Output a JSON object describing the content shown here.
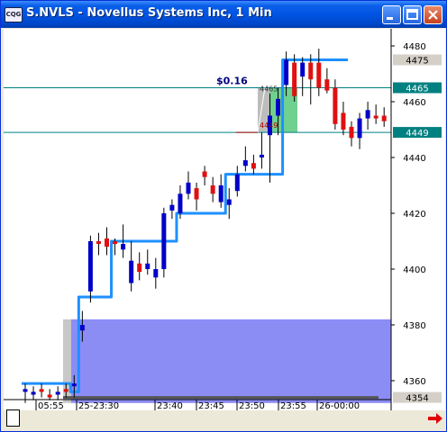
{
  "window": {
    "title": "S.NVLS - Novellus Systems Inc, 1 Min",
    "icon_text": "CQG"
  },
  "chart_data": {
    "type": "candlestick",
    "symbol": "S.NVLS",
    "interval": "1 Min",
    "ylim": [
      4350,
      4485
    ],
    "y_ticks": [
      "4480",
      "4460",
      "4440",
      "4420",
      "4400",
      "4380",
      "4360"
    ],
    "x_labels": [
      "05:55",
      "25-23:30",
      "23:40",
      "23:45",
      "23:50",
      "23:55",
      "26-00:00"
    ],
    "price_tags": [
      {
        "value": 4475,
        "label": "4475",
        "color": "#d4d0c8"
      },
      {
        "value": 4465,
        "label": "4465",
        "color": "#008080"
      },
      {
        "value": 4449,
        "label": "4449",
        "color": "#008080"
      },
      {
        "value": 4354,
        "label": "4354",
        "color": "#d4d0c8"
      }
    ],
    "horizontal_lines": [
      4465,
      4449
    ],
    "annotation": {
      "label": "$0.16",
      "from_label": "4449",
      "to_label": "4465",
      "from": 4449,
      "to": 4465
    },
    "candles": [
      {
        "o": 4356,
        "h": 4359,
        "l": 4352,
        "c": 4357,
        "color": "blue"
      },
      {
        "o": 4356,
        "h": 4358,
        "l": 4353,
        "c": 4355,
        "color": "blue"
      },
      {
        "o": 4357,
        "h": 4359,
        "l": 4354,
        "c": 4356,
        "color": "red"
      },
      {
        "o": 4355,
        "h": 4357,
        "l": 4353,
        "c": 4354,
        "color": "red"
      },
      {
        "o": 4355,
        "h": 4358,
        "l": 4353,
        "c": 4356,
        "color": "blue"
      },
      {
        "o": 4357,
        "h": 4359,
        "l": 4354,
        "c": 4356,
        "color": "red"
      },
      {
        "o": 4359,
        "h": 4362,
        "l": 4354,
        "c": 4358,
        "color": "blue"
      },
      {
        "o": 4378,
        "h": 4385,
        "l": 4374,
        "c": 4380,
        "color": "blue"
      },
      {
        "o": 4392,
        "h": 4412,
        "l": 4388,
        "c": 4410,
        "color": "blue"
      },
      {
        "o": 4410,
        "h": 4413,
        "l": 4405,
        "c": 4409,
        "color": "red"
      },
      {
        "o": 4411,
        "h": 4415,
        "l": 4405,
        "c": 4408,
        "color": "red"
      },
      {
        "o": 4409,
        "h": 4411,
        "l": 4405,
        "c": 4410,
        "color": "red"
      },
      {
        "o": 4409,
        "h": 4416,
        "l": 4404,
        "c": 4407,
        "color": "blue"
      },
      {
        "o": 4403,
        "h": 4410,
        "l": 4392,
        "c": 4395,
        "color": "blue"
      },
      {
        "o": 4402,
        "h": 4406,
        "l": 4396,
        "c": 4399,
        "color": "red"
      },
      {
        "o": 4402,
        "h": 4407,
        "l": 4398,
        "c": 4400,
        "color": "blue"
      },
      {
        "o": 4400,
        "h": 4404,
        "l": 4393,
        "c": 4397,
        "color": "blue"
      },
      {
        "o": 4420,
        "h": 4422,
        "l": 4397,
        "c": 4400,
        "color": "blue"
      },
      {
        "o": 4421,
        "h": 4425,
        "l": 4418,
        "c": 4423,
        "color": "blue"
      },
      {
        "o": 4427,
        "h": 4430,
        "l": 4418,
        "c": 4420,
        "color": "blue"
      },
      {
        "o": 4431,
        "h": 4435,
        "l": 4425,
        "c": 4427,
        "color": "blue"
      },
      {
        "o": 4425,
        "h": 4431,
        "l": 4421,
        "c": 4429,
        "color": "red"
      },
      {
        "o": 4435,
        "h": 4437,
        "l": 4430,
        "c": 4433,
        "color": "red"
      },
      {
        "o": 4430,
        "h": 4433,
        "l": 4424,
        "c": 4427,
        "color": "red"
      },
      {
        "o": 4430,
        "h": 4434,
        "l": 4422,
        "c": 4424,
        "color": "blue"
      },
      {
        "o": 4425,
        "h": 4429,
        "l": 4418,
        "c": 4423,
        "color": "blue"
      },
      {
        "o": 4434,
        "h": 4437,
        "l": 4426,
        "c": 4428,
        "color": "blue"
      },
      {
        "o": 4439,
        "h": 4444,
        "l": 4435,
        "c": 4437,
        "color": "blue"
      },
      {
        "o": 4438,
        "h": 4441,
        "l": 4434,
        "c": 4436,
        "color": "red"
      },
      {
        "o": 4441,
        "h": 4449,
        "l": 4436,
        "c": 4440,
        "color": "blue"
      },
      {
        "o": 4455,
        "h": 4463,
        "l": 4431,
        "c": 4448,
        "color": "blue"
      },
      {
        "o": 4461,
        "h": 4465,
        "l": 4448,
        "c": 4455,
        "color": "blue"
      },
      {
        "o": 4475,
        "h": 4478,
        "l": 4462,
        "c": 4466,
        "color": "blue"
      },
      {
        "o": 4474,
        "h": 4477,
        "l": 4460,
        "c": 4462,
        "color": "red"
      },
      {
        "o": 4474,
        "h": 4476,
        "l": 4462,
        "c": 4469,
        "color": "blue"
      },
      {
        "o": 4468,
        "h": 4477,
        "l": 4459,
        "c": 4474,
        "color": "red"
      },
      {
        "o": 4474,
        "h": 4479,
        "l": 4462,
        "c": 4465,
        "color": "red"
      },
      {
        "o": 4468,
        "h": 4472,
        "l": 4463,
        "c": 4464,
        "color": "red"
      },
      {
        "o": 4465,
        "h": 4468,
        "l": 4450,
        "c": 4452,
        "color": "red"
      },
      {
        "o": 4456,
        "h": 4460,
        "l": 4448,
        "c": 4450,
        "color": "red"
      },
      {
        "o": 4451,
        "h": 4453,
        "l": 4444,
        "c": 4447,
        "color": "red"
      },
      {
        "o": 4447,
        "h": 4456,
        "l": 4443,
        "c": 4454,
        "color": "blue"
      },
      {
        "o": 4454,
        "h": 4460,
        "l": 4450,
        "c": 4457,
        "color": "blue"
      },
      {
        "o": 4455,
        "h": 4459,
        "l": 4452,
        "c": 4454,
        "color": "red"
      },
      {
        "o": 4455,
        "h": 4458,
        "l": 4451,
        "c": 4453,
        "color": "red"
      }
    ],
    "step_line": [
      [
        0,
        4359
      ],
      [
        5,
        4359
      ],
      [
        6,
        4356
      ],
      [
        7,
        4390
      ],
      [
        10,
        4390
      ],
      [
        11,
        4410
      ],
      [
        18,
        4410
      ],
      [
        19,
        4420
      ],
      [
        24,
        4420
      ],
      [
        25,
        4434
      ],
      [
        29,
        4434
      ],
      [
        30,
        4434
      ],
      [
        31,
        4434
      ],
      [
        32,
        4475
      ],
      [
        40,
        4475
      ]
    ],
    "blue_zone": {
      "y_from": 4352,
      "y_to": 4382
    },
    "green_box": {
      "y_from": 4449,
      "y_to": 4465
    }
  },
  "colors": {
    "up_candle": "#0000c8",
    "down_candle": "#e01010",
    "step_line": "#1e90ff",
    "zone_fill": "#8c8cf5",
    "green_fill": "#70d090",
    "teal_line": "#008080",
    "accent_red": "#e00000"
  }
}
